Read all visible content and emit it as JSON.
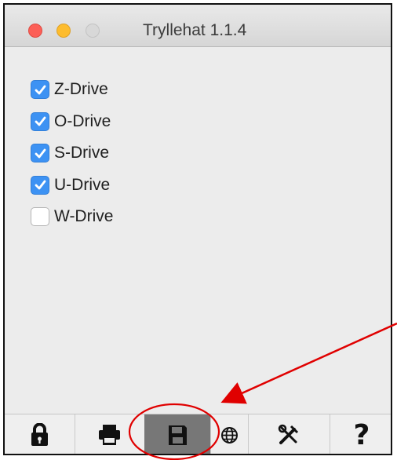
{
  "window": {
    "title": "Tryllehat 1.1.4"
  },
  "drives": [
    {
      "label": "Z-Drive",
      "checked": true
    },
    {
      "label": "O-Drive",
      "checked": true
    },
    {
      "label": "S-Drive",
      "checked": true
    },
    {
      "label": "U-Drive",
      "checked": true
    },
    {
      "label": "W-Drive",
      "checked": false
    }
  ],
  "toolbar": {
    "selected": "save",
    "icons": [
      "lock-icon",
      "printer-icon",
      "save-icon",
      "globe-icon",
      "tools-icon",
      "help-icon"
    ],
    "help_label": "?"
  },
  "colors": {
    "close": "#fc5f57",
    "minimize": "#fdbc2e",
    "zoom_disabled": "#d8d8d8",
    "checkbox_checked": "#3d92f3",
    "selected_tool_background": "#777777",
    "annotation": "#e00000"
  }
}
